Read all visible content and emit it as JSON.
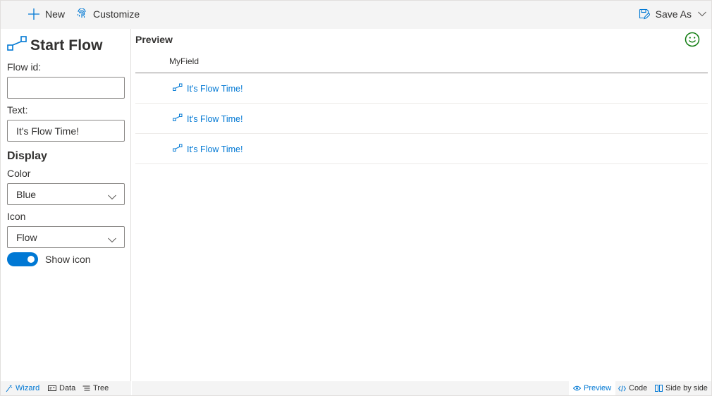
{
  "toolbar": {
    "new_label": "New",
    "customize_label": "Customize",
    "save_as_label": "Save As"
  },
  "wizard": {
    "title": "Start Flow",
    "flow_id": {
      "label": "Flow id:",
      "value": ""
    },
    "text": {
      "label": "Text:",
      "value": "It's Flow Time!"
    },
    "display_section": "Display",
    "color": {
      "label": "Color",
      "value": "Blue"
    },
    "icon": {
      "label": "Icon",
      "value": "Flow"
    },
    "show_icon": {
      "label": "Show icon",
      "on": true
    }
  },
  "preview": {
    "title": "Preview",
    "column_header": "MyField",
    "rows": [
      "It's Flow Time!",
      "It's Flow Time!",
      "It's Flow Time!"
    ]
  },
  "bottom_left_tabs": [
    {
      "label": "Wizard",
      "icon": "wand-icon",
      "active": true
    },
    {
      "label": "Data",
      "icon": "data-icon",
      "active": false
    },
    {
      "label": "Tree",
      "icon": "tree-icon",
      "active": false
    }
  ],
  "bottom_right_tabs": [
    {
      "label": "Preview",
      "icon": "eye-icon",
      "active": true
    },
    {
      "label": "Code",
      "icon": "code-icon",
      "active": false
    },
    {
      "label": "Side by side",
      "icon": "side-by-side-icon",
      "active": false
    }
  ],
  "colors": {
    "accent": "#0078d4",
    "smiley": "#107c10",
    "bar_bg": "#f4f4f4"
  }
}
